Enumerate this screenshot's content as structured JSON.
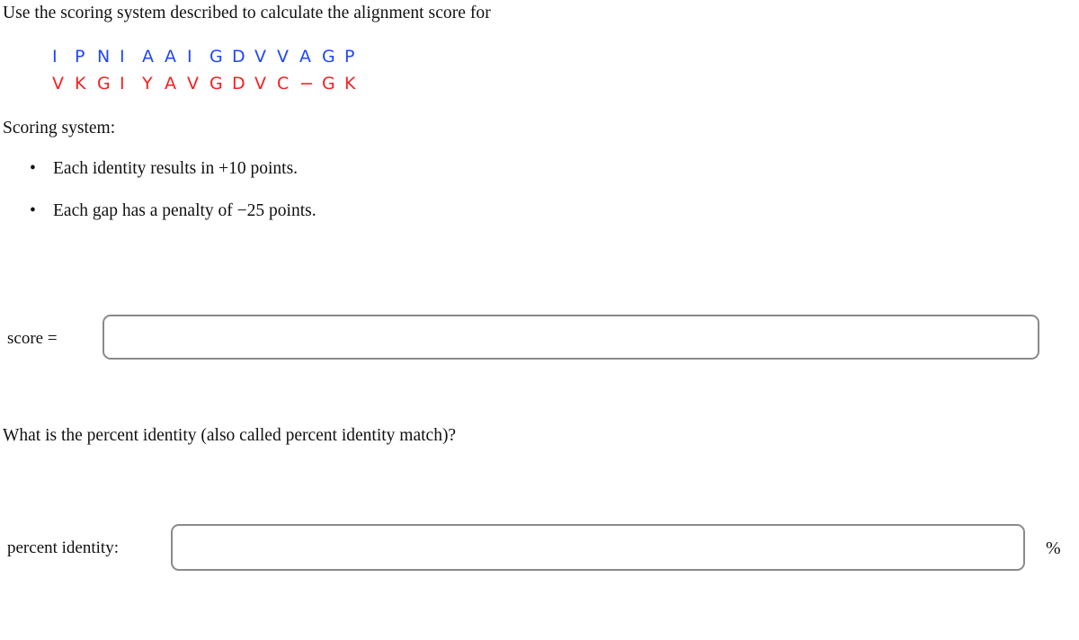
{
  "prompt": {
    "text": "Use the scoring system described to calculate the alignment score for"
  },
  "alignment": {
    "top_sequence_color": "#1f45ff",
    "bottom_sequence_color": "#fb1c1c",
    "top_sequence": [
      "I",
      "P",
      "N",
      "I",
      "A",
      "A",
      "I",
      "G",
      "D",
      "V",
      "V",
      "A",
      "G",
      "P"
    ],
    "bottom_sequence": [
      "V",
      "K",
      "G",
      "I",
      "Y",
      "A",
      "V",
      "G",
      "D",
      "V",
      "C",
      "−",
      "G",
      "K"
    ],
    "top_sequence_text": "I P N I A A I G D V V A G P",
    "bottom_sequence_text": "V K G I Y A V G D V C − G K"
  },
  "scoring": {
    "heading": "Scoring system:",
    "bullet_glyph": "•",
    "rules": [
      "Each identity results in +10 points.",
      "Each gap has a penalty of −25 points."
    ]
  },
  "score_answer": {
    "label": "score =",
    "value": "",
    "placeholder": ""
  },
  "percent_question": {
    "text": "What is the percent identity (also called percent identity match)?"
  },
  "percent_answer": {
    "label": "percent identity:",
    "value": "",
    "placeholder": "",
    "unit": "%"
  }
}
